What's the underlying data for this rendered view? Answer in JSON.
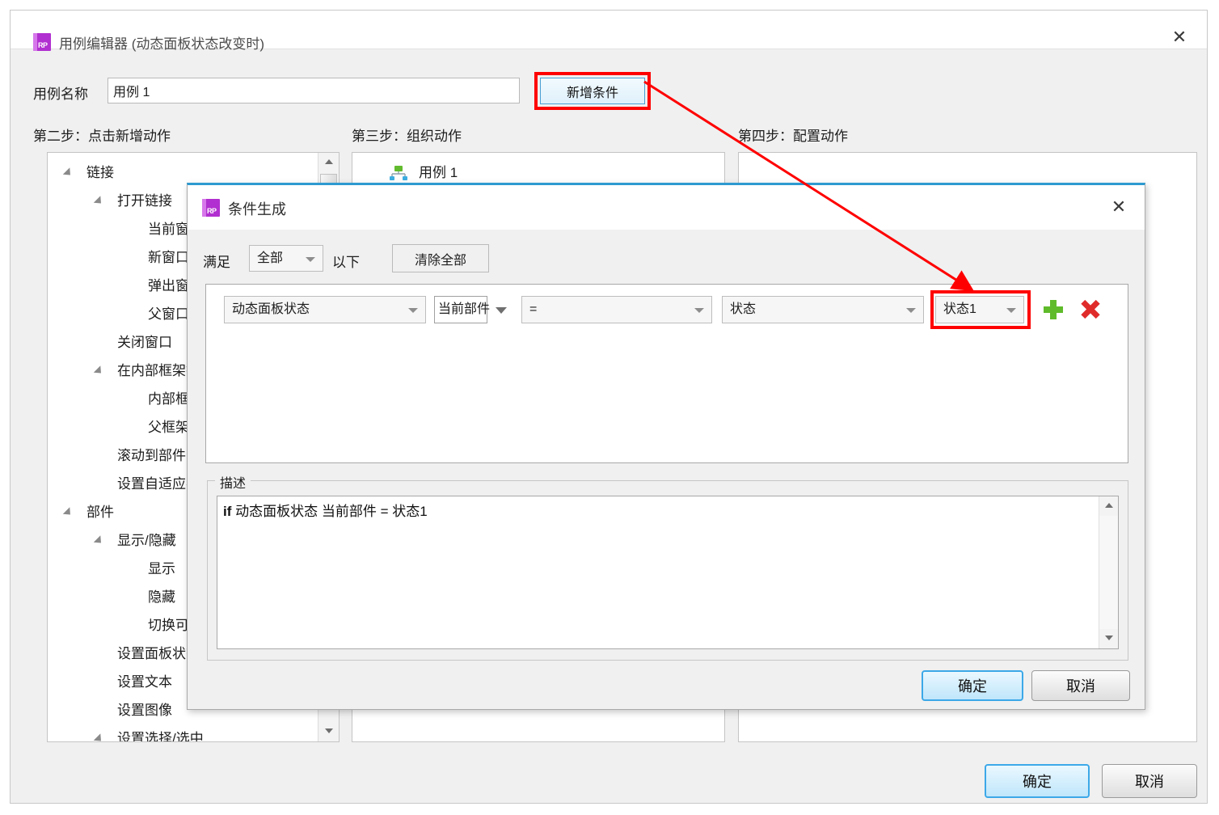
{
  "window": {
    "icon": "rp-app-icon",
    "icon_text": "RP",
    "title": "用例编辑器 (动态面板状态改变时)",
    "close_glyph": "✕",
    "ok_label": "确定",
    "cancel_label": "取消"
  },
  "form": {
    "name_label": "用例名称",
    "name_value": "用例 1",
    "name_placeholder": "用例 1",
    "add_condition_label": "新增条件"
  },
  "steps": {
    "step2": "第二步：点击新增动作",
    "step3": "第三步：组织动作",
    "step4": "第四步：配置动作"
  },
  "action_tree": [
    {
      "label": "链接",
      "level": 0,
      "expandable": true
    },
    {
      "label": "打开链接",
      "level": 1,
      "expandable": true
    },
    {
      "label": "当前窗口",
      "level": 2,
      "expandable": false
    },
    {
      "label": "新窗口/标签",
      "level": 2,
      "expandable": false
    },
    {
      "label": "弹出窗口",
      "level": 2,
      "expandable": false
    },
    {
      "label": "父窗口",
      "level": 2,
      "expandable": false
    },
    {
      "label": "关闭窗口",
      "level": 1,
      "expandable": false
    },
    {
      "label": "在内部框架打开",
      "level": 1,
      "expandable": true
    },
    {
      "label": "内部框架",
      "level": 2,
      "expandable": false
    },
    {
      "label": "父框架",
      "level": 2,
      "expandable": false
    },
    {
      "label": "滚动到部件(锚点链接)",
      "level": 1,
      "expandable": false
    },
    {
      "label": "设置自适应视图",
      "level": 1,
      "expandable": false
    },
    {
      "label": "部件",
      "level": 0,
      "expandable": true
    },
    {
      "label": "显示/隐藏",
      "level": 1,
      "expandable": true
    },
    {
      "label": "显示",
      "level": 2,
      "expandable": false
    },
    {
      "label": "隐藏",
      "level": 2,
      "expandable": false
    },
    {
      "label": "切换可见性",
      "level": 2,
      "expandable": false
    },
    {
      "label": "设置面板状态",
      "level": 1,
      "expandable": false
    },
    {
      "label": "设置文本",
      "level": 1,
      "expandable": false
    },
    {
      "label": "设置图像",
      "level": 1,
      "expandable": false
    },
    {
      "label": "设置选择/选中",
      "level": 1,
      "expandable": true
    }
  ],
  "organize": {
    "usecase_icon": "sitemap-icon",
    "usecase_label": "用例 1"
  },
  "condition_dialog": {
    "icon": "rp-app-icon",
    "icon_text": "RP",
    "title": "条件生成",
    "close_glyph": "✕",
    "satisfy_label": "满足",
    "satisfy_value": "全部",
    "satisfy_suffix": "以下",
    "clear_all_label": "清除全部",
    "row": {
      "field": "动态面板状态",
      "target": "当前部件",
      "operator": "=",
      "property": "状态",
      "value": "状态1",
      "add_glyph": "+",
      "delete_glyph": "✕"
    },
    "description_legend": "描述",
    "description_prefix": "if",
    "description_text": "动态面板状态 当前部件 = 状态1",
    "ok_label": "确定",
    "cancel_label": "取消"
  },
  "annotations": {
    "highlight_color": "#ff0000",
    "arrow_from": "新增条件",
    "arrow_to": "状态1"
  }
}
